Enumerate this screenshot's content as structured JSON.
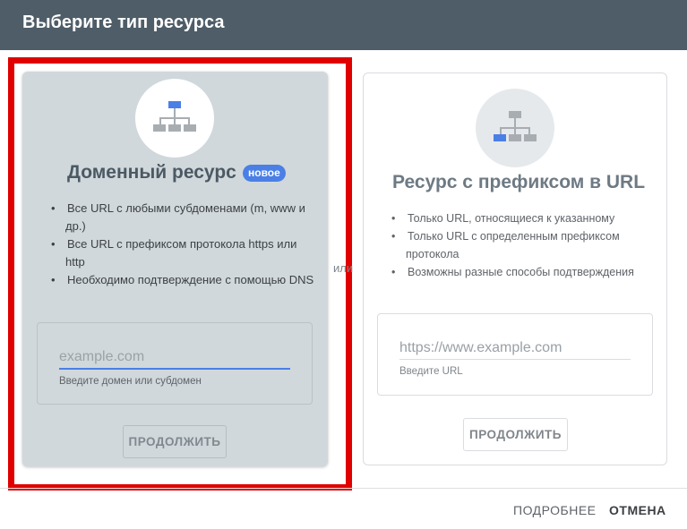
{
  "dialog": {
    "title": "Выберите тип ресурса"
  },
  "domain_card": {
    "title": "Доменный ресурс",
    "badge": "новое",
    "bullets": [
      "Все URL с любыми субдоменами (m, www и др.)",
      "Все URL с префиксом протокола https или http",
      "Необходимо подтверждение с помощью DNS"
    ],
    "input_placeholder": "example.com",
    "input_value": "",
    "input_hint": "Введите домен или субдомен",
    "continue_label": "ПРОДОЛЖИТЬ",
    "icon": "sitemap-icon"
  },
  "separator": {
    "label": "или"
  },
  "url_card": {
    "title": "Ресурс с префиксом в URL",
    "bullets": [
      "Только URL, относящиеся к указанному",
      "Только URL с определенным префиксом протокола",
      "Возможны разные способы подтверждения"
    ],
    "input_placeholder": "https://www.example.com",
    "input_value": "",
    "input_hint": "Введите URL",
    "continue_label": "ПРОДОЛЖИТЬ",
    "icon": "sitemap-icon"
  },
  "footer": {
    "learn_more_label": "ПОДРОБНЕЕ",
    "cancel_label": "ОТМЕНА"
  },
  "colors": {
    "header_bg": "#4e5d67",
    "selected_card_bg": "#d0d8dc",
    "highlight_border": "#e00000",
    "accent": "#4a7fe6"
  }
}
